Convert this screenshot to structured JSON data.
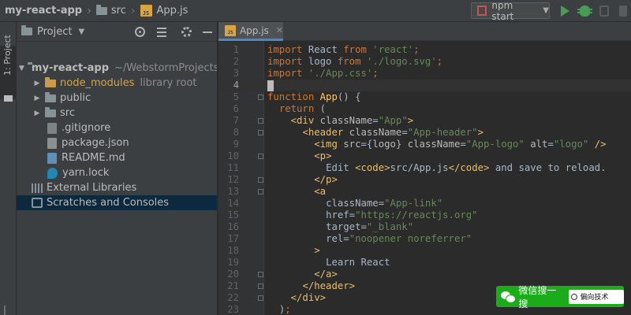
{
  "navbar": {
    "project_name": "my-react-app",
    "folder": "src",
    "file": "App.js",
    "js_badge": "JS"
  },
  "toolbar": {
    "run_config": "npm start",
    "icons": [
      "run-icon",
      "debug-icon",
      "coverage-icon",
      "stop-icon"
    ]
  },
  "left_strip": {
    "project_tab": "1: Project"
  },
  "project_panel": {
    "title": "Project",
    "header_icons": [
      "locate-icon",
      "collapse-all-icon",
      "gear-icon",
      "minimize-icon"
    ],
    "tree": [
      {
        "label": "my-react-app",
        "extra": "~/WebstormProjects",
        "type": "root",
        "expanded": true
      },
      {
        "label": "node_modules",
        "extra": "library root",
        "type": "excluded-folder",
        "expanded": false
      },
      {
        "label": "public",
        "extra": "",
        "type": "folder",
        "expanded": false
      },
      {
        "label": "src",
        "extra": "",
        "type": "folder",
        "expanded": false
      },
      {
        "label": ".gitignore",
        "extra": "",
        "type": "file"
      },
      {
        "label": "package.json",
        "extra": "",
        "type": "file"
      },
      {
        "label": "README.md",
        "extra": "",
        "type": "file"
      },
      {
        "label": "yarn.lock",
        "extra": "",
        "type": "file"
      },
      {
        "label": "External Libraries",
        "extra": "",
        "type": "libraries"
      },
      {
        "label": "Scratches and Consoles",
        "extra": "",
        "type": "scratches",
        "selected": true
      }
    ]
  },
  "editor": {
    "tab": {
      "label": "App.js",
      "badge": "JS"
    },
    "current_line": 4,
    "lines": [
      "import React from 'react';",
      "import logo from './logo.svg';",
      "import './App.css';",
      "",
      "function App() {",
      "  return (",
      "    <div className=\"App\">",
      "      <header className=\"App-header\">",
      "        <img src={logo} className=\"App-logo\" alt=\"logo\" />",
      "        <p>",
      "          Edit <code>src/App.js</code> and save to reload.",
      "        </p>",
      "        <a",
      "          className=\"App-link\"",
      "          href=\"https://reactjs.org\"",
      "          target=\"_blank\"",
      "          rel=\"noopener noreferrer\"",
      "        >",
      "          Learn React",
      "        </a>",
      "      </header>",
      "    </div>",
      "  );",
      "}"
    ]
  },
  "watermark": {
    "text": "微信搜一搜",
    "search": "偏向技术"
  }
}
